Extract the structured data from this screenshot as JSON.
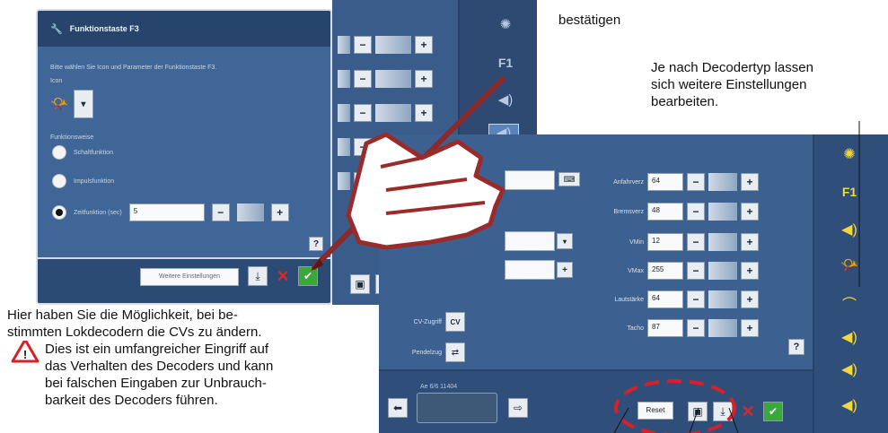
{
  "annotations": {
    "top": "bestätigen",
    "right": [
      "Je nach Decodertyp lassen",
      "sich weitere Einstellungen",
      "bearbeiten."
    ],
    "left": [
      "Hier haben Sie die Möglichkeit, bei be-",
      "stimmten Lokdecodern die CVs zu ändern."
    ],
    "warning": [
      "Dies ist ein umfangreicher Eingriff auf",
      "das Verhalten des Decoders und kann",
      "bei falschen Eingaben zur Unbrauch-",
      "barkeit des Decoders führen."
    ]
  },
  "dialog": {
    "title": "Funktionstaste F3",
    "prompt": "Bitte wählen Sie Icon und Parameter der Funktionstaste F3.",
    "icon_label": "Icon",
    "mode_label": "Funktionsweise",
    "options": [
      {
        "label": "Schaltfunktion",
        "selected": false
      },
      {
        "label": "Impulsfunktion",
        "selected": false
      },
      {
        "label": "Zeitfunktion (sec)",
        "selected": true
      }
    ],
    "time_value": "5",
    "more_settings": "Weitere Einstellungen",
    "help": "?"
  },
  "main": {
    "rows": [
      {
        "label": "Anfahrverz",
        "value": "64"
      },
      {
        "label": "Bremsverz",
        "value": "48"
      },
      {
        "label": "VMin",
        "value": "12"
      },
      {
        "label": "VMax",
        "value": "255"
      },
      {
        "label": "Lautstärke",
        "value": "64"
      },
      {
        "label": "Tacho",
        "value": "87"
      }
    ],
    "cv_label": "CV-Zugriff",
    "shuttle_label": "Pendelzug",
    "help": "?",
    "loco_name": "Ae 6/6 11404",
    "reset": "Reset"
  },
  "back": {
    "f1": "F1"
  },
  "colors": {
    "panel_blue": "#3c6190",
    "icon_yellow": "#f2d73d",
    "confirm_green": "#3aa83a",
    "cancel_red": "#d42a2a",
    "highlight_dash": "#d8202a"
  }
}
